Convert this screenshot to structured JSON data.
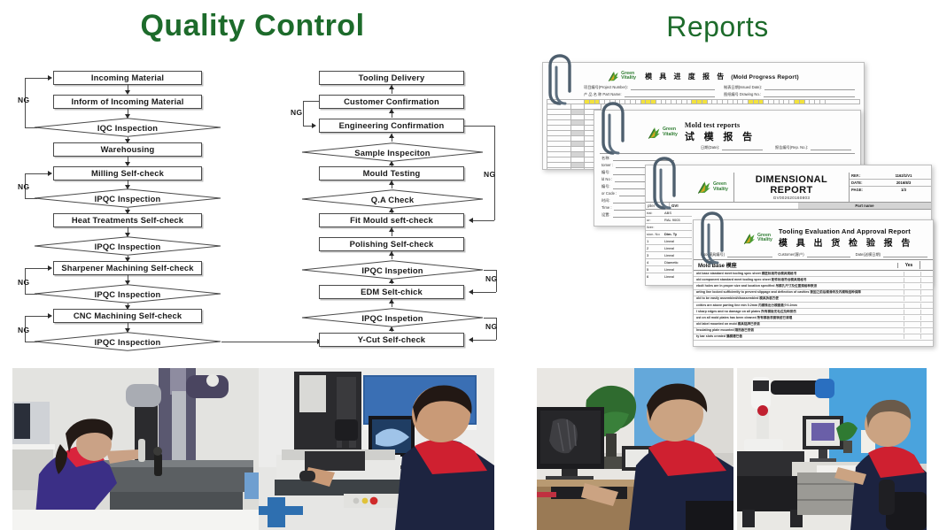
{
  "page": {
    "background": "#ffffff",
    "accent_green": "#1d6b2b",
    "logo_green": "#2f7d32"
  },
  "sections": {
    "quality_control": {
      "title": "Quality Control"
    },
    "reports": {
      "title": "Reports"
    }
  },
  "flowchart": {
    "ng_label": "NG",
    "left_column": [
      {
        "id": "incoming-material",
        "label": "Incoming Material",
        "shape": "box"
      },
      {
        "id": "inform-of-incoming-material",
        "label": "Inform of Incoming Material",
        "shape": "box"
      },
      {
        "id": "iqc-inspection",
        "label": "IQC Inspection",
        "shape": "diamond"
      },
      {
        "id": "warehousing",
        "label": "Warehousing",
        "shape": "box"
      },
      {
        "id": "milling-self-check",
        "label": "Milling Self-check",
        "shape": "box"
      },
      {
        "id": "ipqc-inspection-1",
        "label": "IPQC Inspection",
        "shape": "diamond"
      },
      {
        "id": "heat-treatments-self-check",
        "label": "Heat Treatments Self-check",
        "shape": "box"
      },
      {
        "id": "ipqc-inspection-2",
        "label": "IPQC Inspection",
        "shape": "diamond"
      },
      {
        "id": "sharpener-machining-self-check",
        "label": "Sharpener Machining Self-check",
        "shape": "box"
      },
      {
        "id": "ipqc-inspection-3",
        "label": "IPQC Inspection",
        "shape": "diamond"
      },
      {
        "id": "cnc-machining-self-check",
        "label": "CNC Machining Self-check",
        "shape": "box"
      },
      {
        "id": "ipqc-inspection-4",
        "label": "IPQC Inspection",
        "shape": "diamond"
      }
    ],
    "right_column": [
      {
        "id": "tooling-delivery",
        "label": "Tooling Delivery",
        "shape": "box"
      },
      {
        "id": "customer-confirmation",
        "label": "Customer Confirmation",
        "shape": "box"
      },
      {
        "id": "engineering-confirmation",
        "label": "Engineering Confirmation",
        "shape": "box"
      },
      {
        "id": "sample-inspeciton",
        "label": "Sample Inspeciton",
        "shape": "diamond"
      },
      {
        "id": "mould-testing",
        "label": "Mould Testing",
        "shape": "box"
      },
      {
        "id": "qa-check",
        "label": "Q.A Check",
        "shape": "diamond"
      },
      {
        "id": "fit-mould-seft-check",
        "label": "Fit Mould seft-check",
        "shape": "box"
      },
      {
        "id": "polishing-self-check",
        "label": "Polishing Self-check",
        "shape": "box"
      },
      {
        "id": "ipqc-inspetion-1",
        "label": "IPQC Inspetion",
        "shape": "diamond"
      },
      {
        "id": "edm-selt-chick",
        "label": "EDM Selt-chick",
        "shape": "box"
      },
      {
        "id": "ipqc-inspetion-2",
        "label": "IPQC Inspetion",
        "shape": "diamond"
      },
      {
        "id": "y-cut-self-check",
        "label": "Y-Cut Self-check",
        "shape": "box"
      }
    ],
    "ng_labels_left": [
      "NG",
      "NG",
      "NG",
      "NG"
    ],
    "ng_labels_right": [
      "NG",
      "NG",
      "NG",
      "NG"
    ]
  },
  "reports_documents": [
    {
      "id": "mold-progress-report",
      "logo": {
        "line1": "Green",
        "line2": "Vitality"
      },
      "title_cn": "模 具 进 度 报 告",
      "title_en": "(Mold Progress Report)",
      "fields": [
        {
          "label": "项目编号(Project Number):"
        },
        {
          "label": "产 品 名 称 Part Name:"
        },
        {
          "label": "制表日期(Issued Date):"
        },
        {
          "label": "图纸编号 Drawing No.:"
        }
      ]
    },
    {
      "id": "mold-test-report",
      "logo": {
        "line1": "Green",
        "line2": "Vitality"
      },
      "title_en": "Mold test reports",
      "title_cn": "试 模 报 告",
      "fields": [
        {
          "label": "日期(Date):"
        },
        {
          "label": "报告编号(Rep. No.):"
        },
        {
          "label": "名称:"
        },
        {
          "label": "tomer :"
        },
        {
          "label": "编号:"
        },
        {
          "label": "ld No :"
        },
        {
          "label": "编号:"
        },
        {
          "label": "or Code :"
        },
        {
          "label": "时间:"
        },
        {
          "label": "Time :"
        },
        {
          "label": "设置:"
        }
      ]
    },
    {
      "id": "dimensional-report",
      "logo": {
        "line1": "Green",
        "line2": "Vitality"
      },
      "title_en": "DIMENSIONAL REPORT",
      "doc_no": "GV002620160803",
      "meta": [
        {
          "key": "REF.:",
          "value": "1162/1/V1"
        },
        {
          "key": "DATE:",
          "value": "2016/8/3"
        },
        {
          "key": "PAGE:",
          "value": "1/3"
        }
      ],
      "part_name_label": "Part name",
      "left_fields": [
        {
          "key": "plier",
          "value": "GVI"
        },
        {
          "key": "rial:",
          "value": "ABS"
        },
        {
          "key": "ur:",
          "value": "RAL 9003"
        },
        {
          "key": "ilver:",
          "value": ""
        },
        {
          "key": "sion. No",
          "value": "Dim. Ty"
        }
      ],
      "rows": [
        {
          "no": "1",
          "type": "Lineal"
        },
        {
          "no": "2",
          "type": "Lineal"
        },
        {
          "no": "3",
          "type": "Lineal"
        },
        {
          "no": "4",
          "type": "Diametic"
        },
        {
          "no": "5",
          "type": "Lineal"
        },
        {
          "no": "6",
          "type": "Lineal"
        }
      ]
    },
    {
      "id": "tooling-evaluation-and-approval-report",
      "logo": {
        "line1": "Green",
        "line2": "Vitality"
      },
      "title_en": "Tooling Evaluation And Approval Report",
      "title_cn": "模 具 出 货 检 验 报 告",
      "header_fields": [
        {
          "label": "l No(模具编号)"
        },
        {
          "label": "Customer(客户)"
        },
        {
          "label": "Date(送模日期)"
        }
      ],
      "section_title": "Mold Base 模座",
      "yes_column": "Yes",
      "checklist": [
        "old base standard meet tooling spec sheet 模胚标准符合模具规格书",
        "old component standard meet tooling spec sheet 配件标准符合模具规格书",
        "ebolt holes are in proper size and location specified 吊模孔尺寸及位置规格种数适",
        "arting line locked sufficiently to prevent slippage and deflection of cavities 锁固之前后模滑块及内模珠结种保障",
        "old to be easily assembled/disassembled 模具拆装方便",
        "cvities are above parting line min 0.2mm 内模珠出分模面最少0.2mm",
        "l sharp edges and no damage on all plates 所有模板无毛边及种损伤",
        "ust on all mold plates has been cleaned 所有模板表面锈迹已清理",
        "old label mounted on mold 模具铭牌已安装",
        "Insulating plate mounted 隔热板已安装",
        "ty bar slots created 撬模槽已做"
      ]
    }
  ],
  "photos": [
    {
      "id": "cmm-operator-inspection",
      "alt": "Operator inspecting part on coordinate measuring machine"
    },
    {
      "id": "vision-measuring-machine",
      "alt": "Technician operating vision measuring machine with monitor"
    },
    {
      "id": "cad-workstation-engineer",
      "alt": "Engineer reviewing 3D model on computer workstation"
    },
    {
      "id": "cmm-room-engineer",
      "alt": "Engineer at CMM measurement workstation in metrology room"
    }
  ]
}
